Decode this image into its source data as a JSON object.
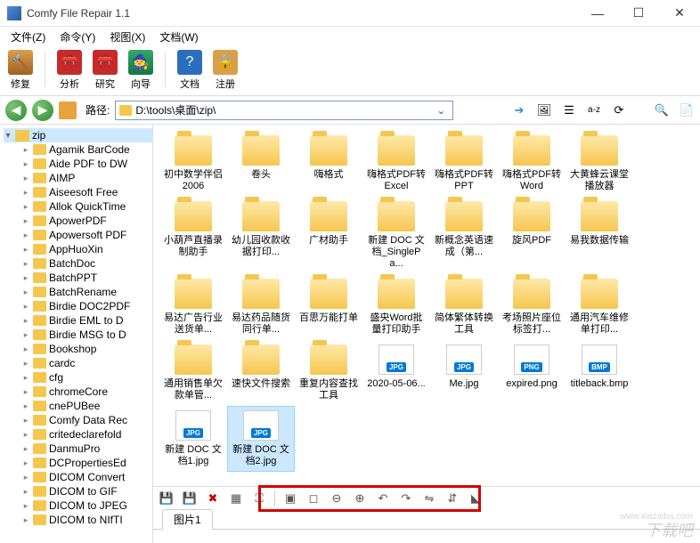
{
  "window": {
    "title": "Comfy File Repair 1.1"
  },
  "menu": {
    "file": "文件(Z)",
    "command": "命令(Y)",
    "view": "视图(X)",
    "doc": "文档(W)"
  },
  "toolbar": {
    "repair": "修复",
    "analyze": "分析",
    "research": "研究",
    "wizard": "向导",
    "doc": "文档",
    "register": "注册"
  },
  "nav": {
    "path_label": "路径:",
    "path_value": "D:\\tools\\桌面\\zip\\"
  },
  "tree": {
    "root": "zip",
    "items": [
      "Agamik BarCode",
      "Aide PDF to DW",
      "AIMP",
      "Aiseesoft Free",
      "Allok QuickTime",
      "ApowerPDF",
      "Apowersoft PDF",
      "AppHuoXin",
      "BatchDoc",
      "BatchPPT",
      "BatchRename",
      "Birdie DOC2PDF",
      "Birdie EML to D",
      "Birdie MSG to D",
      "Bookshop",
      "cardc",
      "cfg",
      "chromeCore",
      "cnePUBee",
      "Comfy Data Rec",
      "critedeclarefold",
      "DanmuPro",
      "DCPropertiesEd",
      "DICOM Convert",
      "DICOM to GIF",
      "DICOM to JPEG",
      "DICOM to NIfTI"
    ]
  },
  "files": [
    {
      "type": "folder",
      "name": "初中数学伴侣2006"
    },
    {
      "type": "folder",
      "name": "卷头"
    },
    {
      "type": "folder",
      "name": "嗨格式"
    },
    {
      "type": "folder",
      "name": "嗨格式PDF转Excel"
    },
    {
      "type": "folder",
      "name": "嗨格式PDF转PPT"
    },
    {
      "type": "folder",
      "name": "嗨格式PDF转Word"
    },
    {
      "type": "folder",
      "name": "大黄蜂云课堂播放器"
    },
    {
      "type": "folder",
      "name": "小葫芦直播录制助手"
    },
    {
      "type": "folder",
      "name": "幼儿园收款收据打印..."
    },
    {
      "type": "folder",
      "name": "广材助手"
    },
    {
      "type": "folder",
      "name": "新建 DOC 文档_SinglePa..."
    },
    {
      "type": "folder",
      "name": "新概念英语速成（第..."
    },
    {
      "type": "folder",
      "name": "旋风PDF"
    },
    {
      "type": "folder",
      "name": "易我数据传输"
    },
    {
      "type": "folder",
      "name": "易达广告行业送货单..."
    },
    {
      "type": "folder",
      "name": "易达药品随货同行单..."
    },
    {
      "type": "folder",
      "name": "百思万能打单"
    },
    {
      "type": "folder",
      "name": "盛央Word批量打印助手"
    },
    {
      "type": "folder",
      "name": "简体繁体转换工具"
    },
    {
      "type": "folder",
      "name": "考场照片座位标签打..."
    },
    {
      "type": "folder",
      "name": "通用汽车维修单打印..."
    },
    {
      "type": "folder",
      "name": "通用销售单欠款单管..."
    },
    {
      "type": "folder",
      "name": "速快文件搜索"
    },
    {
      "type": "folder",
      "name": "重复内容查找工具"
    },
    {
      "type": "jpg",
      "name": "2020-05-06..."
    },
    {
      "type": "jpg",
      "name": "Me.jpg"
    },
    {
      "type": "png",
      "name": "expired.png"
    },
    {
      "type": "bmp",
      "name": "titleback.bmp"
    },
    {
      "type": "jpg",
      "name": "新建 DOC 文档1.jpg"
    },
    {
      "type": "jpg",
      "name": "新建 DOC 文档2.jpg",
      "selected": true
    }
  ],
  "preview": {
    "tab": "图片1"
  },
  "watermark": {
    "main": "下载吧",
    "sub": "www.xiazaiba.com"
  }
}
